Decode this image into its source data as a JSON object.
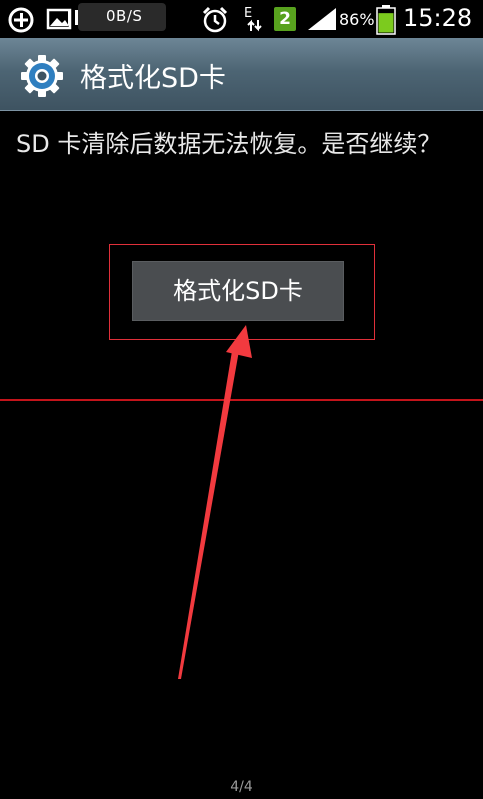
{
  "status_bar": {
    "net_speed": "0B/S",
    "sim_slot": "2",
    "network_type": "E",
    "battery_percent": "86%",
    "battery_level": 0.86,
    "time": "15:28",
    "icons": [
      "add-circle-icon",
      "image-icon",
      "pause-icon",
      "alarm-icon",
      "data-transfer-icon",
      "sim-badge",
      "signal-icon",
      "battery-icon"
    ],
    "colors": {
      "sim": "#58a21e",
      "battery": "#7ccb1e"
    }
  },
  "title_bar": {
    "title": "格式化SD卡",
    "icon": "gear-icon",
    "colors": {
      "gear": "#2f7fc0"
    }
  },
  "content": {
    "message": "SD 卡清除后数据无法恢复。是否继续？",
    "format_button_label": "格式化SD卡"
  },
  "annotation": {
    "colors": {
      "highlight": "#e0303a",
      "line": "#c4141b",
      "arrow": "#f23a3f"
    }
  },
  "footer": {
    "page_indicator": "4/4"
  }
}
